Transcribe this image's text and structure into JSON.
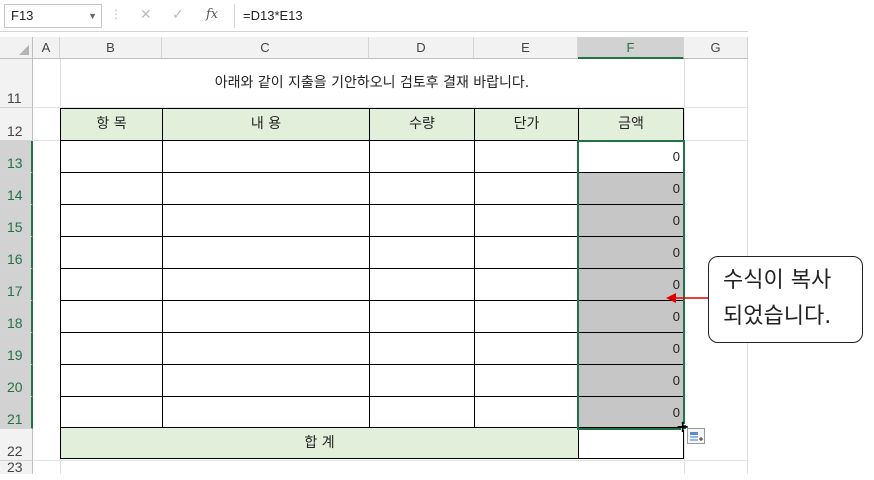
{
  "formula_bar": {
    "name_box": "F13",
    "cancel_icon": "close-icon",
    "enter_icon": "check-icon",
    "fx_label": "fx",
    "formula": "=D13*E13"
  },
  "columns": [
    "A",
    "B",
    "C",
    "D",
    "E",
    "F",
    "G"
  ],
  "rows": [
    "11",
    "12",
    "13",
    "14",
    "15",
    "16",
    "17",
    "18",
    "19",
    "20",
    "21",
    "22",
    "23"
  ],
  "selected_column": "F",
  "form": {
    "title": "아래와 같이 지출을 기안하오니 검토후 결재 바랍니다.",
    "headers": [
      "항 목",
      "내 용",
      "수량",
      "단가",
      "금액"
    ],
    "amounts": [
      "0",
      "0",
      "0",
      "0",
      "0",
      "0",
      "0",
      "0",
      "0"
    ],
    "total_label": "합 계"
  },
  "callout": {
    "line1": "수식이  복사",
    "line2": "되었습니다."
  },
  "colors": {
    "header_fill": "#e2efda",
    "filled_cells": "#c6c6c6",
    "selection": "#217346",
    "arrow": "#e00000"
  }
}
